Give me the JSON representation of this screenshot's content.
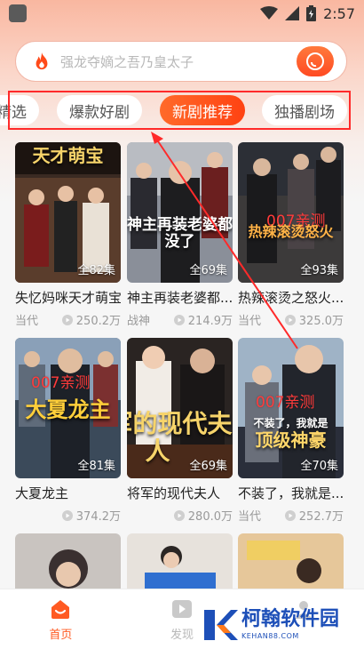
{
  "status_bar": {
    "time": "2:57"
  },
  "search": {
    "placeholder": "强龙夺嫡之吾乃皇太子"
  },
  "tabs": [
    {
      "label": "精选",
      "active": false
    },
    {
      "label": "爆款好剧",
      "active": false
    },
    {
      "label": "新剧推荐",
      "active": true
    },
    {
      "label": "独播剧场",
      "active": false
    }
  ],
  "cards": [
    {
      "title": "失忆妈咪天才萌宝",
      "tag": "当代",
      "views": "250.2万",
      "episodes": "全82集",
      "poster_text": "天才萌宝",
      "watermark": ""
    },
    {
      "title": "神主再装老婆都...",
      "tag": "战神",
      "views": "214.9万",
      "episodes": "全69集",
      "poster_text": "神主再装老婆都没了",
      "watermark": ""
    },
    {
      "title": "热辣滚烫之怒火...",
      "tag": "当代",
      "views": "325.0万",
      "episodes": "全93集",
      "poster_text": "热辣滚烫怒火",
      "watermark": "007亲测"
    },
    {
      "title": "大夏龙主",
      "tag": "",
      "views": "374.2万",
      "episodes": "全81集",
      "poster_text": "大夏龙主",
      "watermark": "007亲测"
    },
    {
      "title": "将军的现代夫人",
      "tag": "",
      "views": "280.0万",
      "episodes": "全69集",
      "poster_text": "将军的现代夫人",
      "watermark": ""
    },
    {
      "title": "不装了，我就是...",
      "tag": "当代",
      "views": "252.7万",
      "episodes": "全70集",
      "poster_text": "顶级神豪",
      "watermark": "007亲测",
      "poster_subtext": "不装了，我就是"
    }
  ],
  "bottom_nav": [
    {
      "label": "首页",
      "icon": "home-icon",
      "active": true
    },
    {
      "label": "发现",
      "icon": "play-square-icon",
      "active": false
    },
    {
      "label": "",
      "icon": "profile-icon",
      "active": false
    }
  ],
  "brand": {
    "name": "柯翰软件园",
    "url": "KEHAN88.COM"
  },
  "colors": {
    "accent": "#ff4a1a",
    "annotation": "#ff2a2a",
    "brand": "#1d4fb8"
  }
}
